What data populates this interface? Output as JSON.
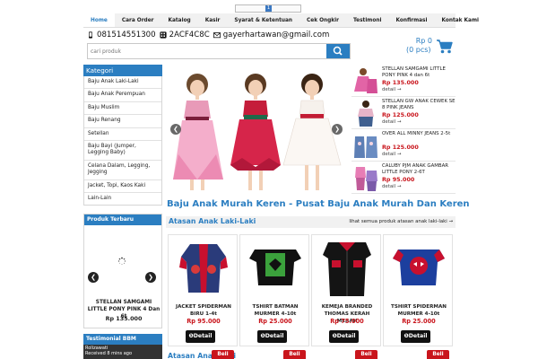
{
  "top_strip": {
    "icon": "page-indicator-icon"
  },
  "nav": {
    "items": [
      "Home",
      "Cara Order",
      "Katalog",
      "Kasir",
      "Syarat & Ketentuan",
      "Cek Ongkir",
      "Testimoni",
      "Konfirmasi",
      "Kontak Kami"
    ]
  },
  "contact": {
    "phone": "081514551300",
    "pin": "2ACF4C8C",
    "email": "gayerhartawan@gmail.com"
  },
  "search": {
    "placeholder": "cari produk"
  },
  "cart": {
    "total": "Rp 0",
    "count": "(0 pcs)"
  },
  "sidebar": {
    "title": "Kategori",
    "items": [
      "Baju Anak Laki-Laki",
      "Baju Anak Perempuan",
      "Baju Muslim",
      "Baju Renang",
      "Setellan",
      "Baju Bayi (Jumper, Legging Baby)",
      "Celana Dalam, Legging, Jegging",
      "Jacket, Topi, Kaos Kaki",
      "Lain-Lain"
    ]
  },
  "produk_terbaru": {
    "title": "Produk Terbaru",
    "name": "STELLAN SAMGAMI LITTLE PONY PINK 4 Dan 6t",
    "price": "Rp 135.000"
  },
  "testimoni": {
    "title": "Testimonial BBM",
    "line1": "Rolizawati",
    "line2": "Received 8 mins ago"
  },
  "mini_products": [
    {
      "name": "STELLAN SAMGAMI LITTLE PONY PINK 4 dan 6t",
      "price": "Rp 135.000",
      "detail": "detail →"
    },
    {
      "name": "STELLAN GW ANAK CEWEK SE 8 PINK JEANS",
      "price": "Rp 125.000",
      "detail": "detail →"
    },
    {
      "name": "OVER ALL MINNY JEANS 2-5t",
      "price": "Rp 125.000",
      "detail": "detail →"
    },
    {
      "name": "CALUBY PJM ANAK GAMBAR LITTLE PONY 2-6T",
      "price": "Rp 95.000",
      "detail": "detail →"
    }
  ],
  "main_title": "Baju Anak Murah Keren - Pusat Baju Anak Murah Dan Keren",
  "section": {
    "title": "Atasan Anak Laki-Laki",
    "link": "lihat semua produk atasan anak laki-laki →"
  },
  "products": [
    {
      "name": "JACKET SPIDERMAN BIRU 1-4t",
      "price": "Rp 95.000",
      "detail": "Detail"
    },
    {
      "name": "TSHIRT BATMAN MURMER 4-10t",
      "price": "Rp 25.000",
      "detail": "Detail"
    },
    {
      "name": "KEMEJA BRANDED THOMAS KERAH MERAH",
      "price": "Rp 75.000",
      "detail": "Detail"
    },
    {
      "name": "TSHIRT SPIDERMAN MURMER 4-10t",
      "price": "Rp 25.000",
      "detail": "Detail"
    }
  ],
  "bottom": {
    "beli": "Beli",
    "section2": "Atasan Anak Laki"
  },
  "colors": {
    "accent": "#2b7ec1",
    "price": "#c9151c",
    "nav_bg": "#f1f1f1"
  }
}
